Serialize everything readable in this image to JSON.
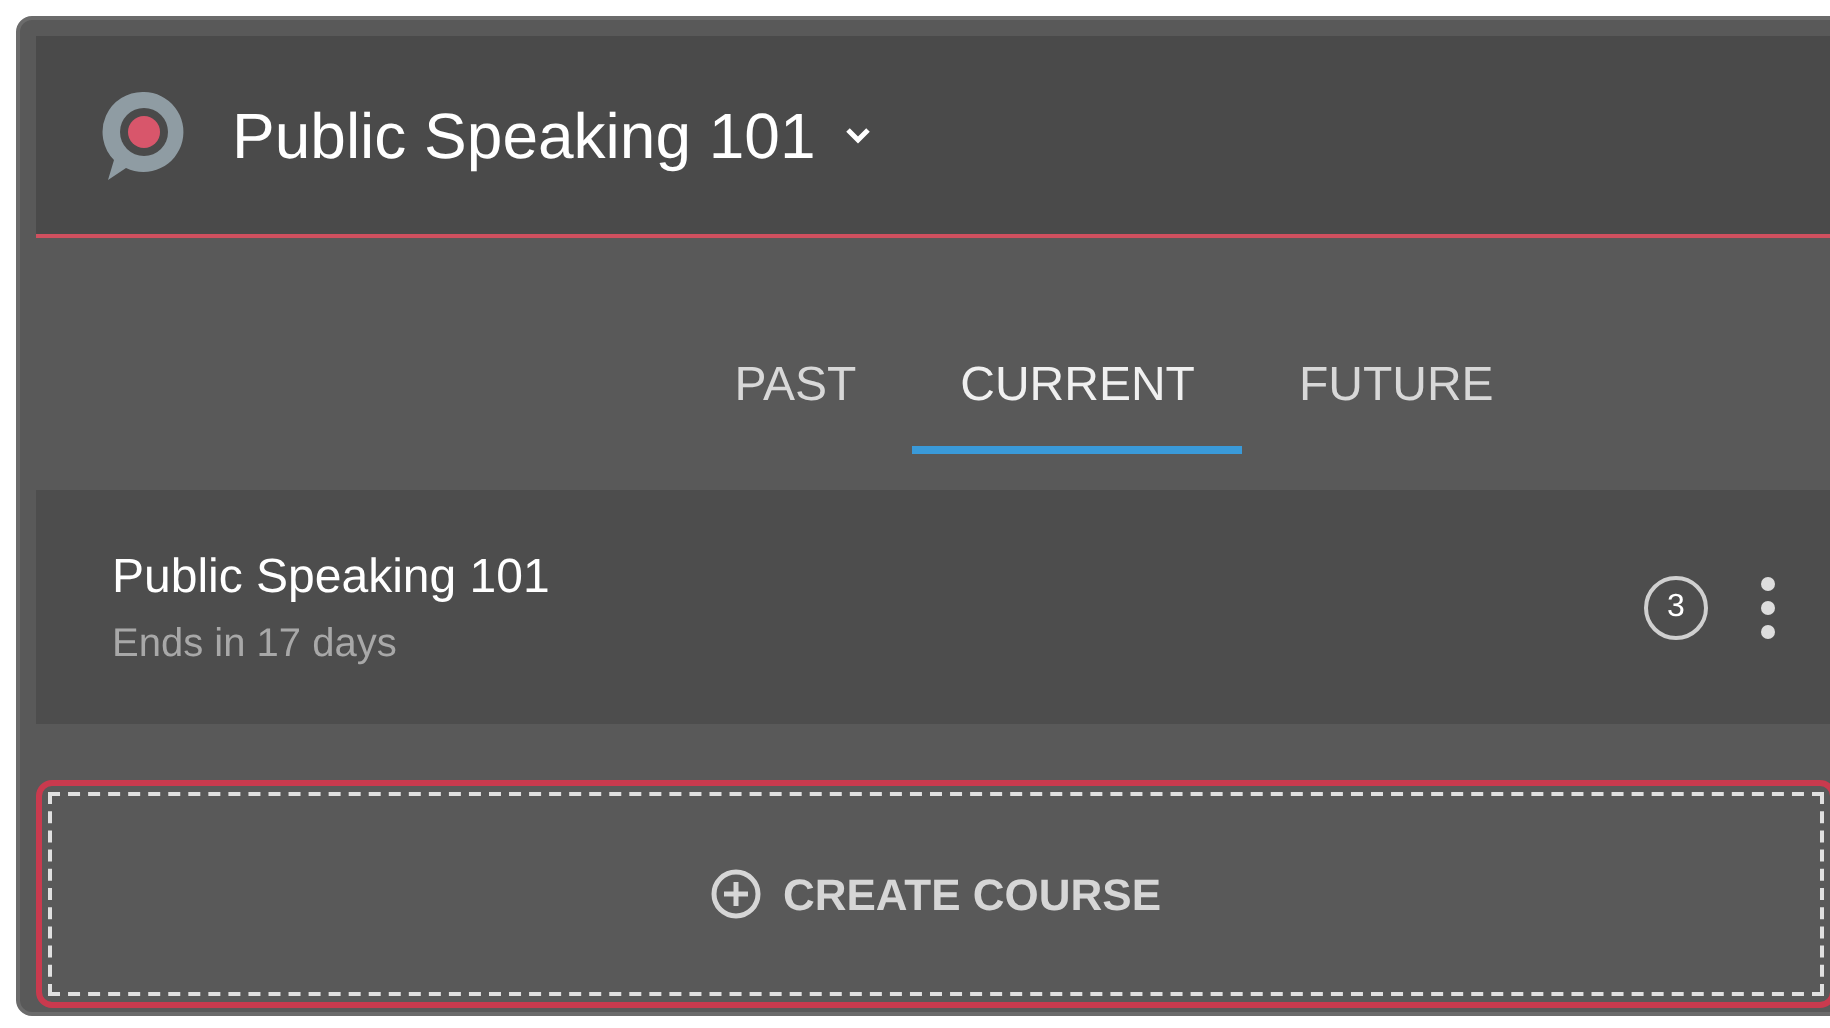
{
  "header": {
    "title": "Public Speaking 101"
  },
  "tabs": [
    {
      "label": "PAST",
      "selected": false
    },
    {
      "label": "CURRENT",
      "selected": true
    },
    {
      "label": "FUTURE",
      "selected": false
    }
  ],
  "courses": [
    {
      "name": "Public Speaking 101",
      "subtitle": "Ends in 17 days",
      "count": "3"
    }
  ],
  "create_button": {
    "label": "CREATE COURSE",
    "focused": true
  }
}
